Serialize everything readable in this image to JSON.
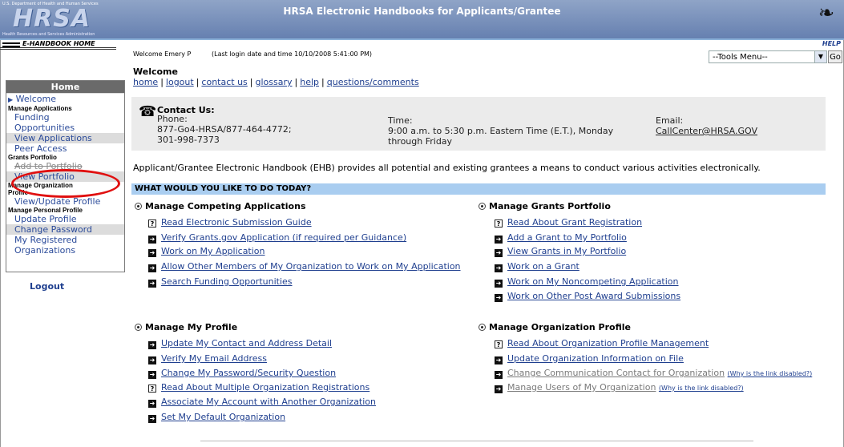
{
  "header": {
    "dept": "U.S. Department of Health and Human Services",
    "logo": "HRSA",
    "logo_sub": "Health Resources and Services Administration",
    "ehb_home": "E-HANDBOOK HOME",
    "title": "HRSA Electronic Handbooks for Applicants/Grantee",
    "help": "HELP"
  },
  "user": {
    "welcome": "Welcome Emery P",
    "last_login": "(Last login date and time 10/10/2008 5:41:00 PM)"
  },
  "tools": {
    "selected": "--Tools Menu--",
    "go": "Go"
  },
  "nav": {
    "header": "Home",
    "welcome": "Welcome",
    "sec_apps": "Manage Applications",
    "funding1": "Funding",
    "funding2": "Opportunities",
    "view_apps": "View Applications",
    "peer": "Peer Access",
    "sec_grants": "Grants Portfolio",
    "add_portfolio": "Add to Portfolio",
    "view_portfolio": "View Portfolio",
    "sec_org1": "Manage Organization",
    "sec_org2": "Profile",
    "view_update": "View/Update Profile",
    "sec_personal": "Manage Personal Profile",
    "update_profile": "Update Profile",
    "change_pw": "Change Password",
    "my_reg1": "My Registered",
    "my_reg2": "Organizations",
    "logout": "Logout"
  },
  "main": {
    "welcome_title": "Welcome",
    "links": [
      "home",
      "logout",
      "contact us",
      "glossary",
      "help",
      "questions/comments"
    ],
    "contact": {
      "title": "Contact Us:",
      "phone_label": "Phone:",
      "phone1": "877-Go4-HRSA/877-464-4772;",
      "phone2": "301-998-7373",
      "time_label": "Time:",
      "time1": "9:00 a.m. to 5:30 p.m. Eastern Time (E.T.), Monday",
      "time2": "through Friday",
      "email_label": "Email:",
      "email": "CallCenter@HRSA.GOV"
    },
    "intro": "Applicant/Grantee Electronic Handbook (EHB) provides all potential and existing grantees a means to conduct various activities electronically.",
    "banner": "WHAT WOULD YOU LIKE TO DO TODAY?",
    "competing": {
      "title": "Manage Competing Applications",
      "items": [
        "Read Electronic Submission Guide",
        "Verify Grants.gov Application (if required per Guidance)",
        "Work on My Application",
        "Allow Other Members of My Organization to Work on My Application",
        "Search Funding Opportunities"
      ]
    },
    "grants": {
      "title": "Manage Grants Portfolio",
      "items": [
        "Read About Grant Registration",
        "Add a Grant to My Portfolio",
        "View Grants in My Portfolio",
        "Work on a Grant",
        "Work on My Noncompeting Application",
        "Work on Other Post Award Submissions"
      ]
    },
    "profile": {
      "title": "Manage My Profile",
      "items": [
        "Update My Contact and Address Detail",
        "Verify My Email Address",
        "Change My Password/Security Question",
        "Read About Multiple Organization Registrations",
        "Associate My Account with Another Organization",
        "Set My Default Organization"
      ]
    },
    "org": {
      "title": "Manage Organization Profile",
      "items": [
        "Read About Organization Profile Management",
        "Update Organization Information on File",
        "Change Communication Contact for Organization",
        "Manage Users of My Organization"
      ],
      "why": "(Why is the link disabled?)"
    }
  }
}
